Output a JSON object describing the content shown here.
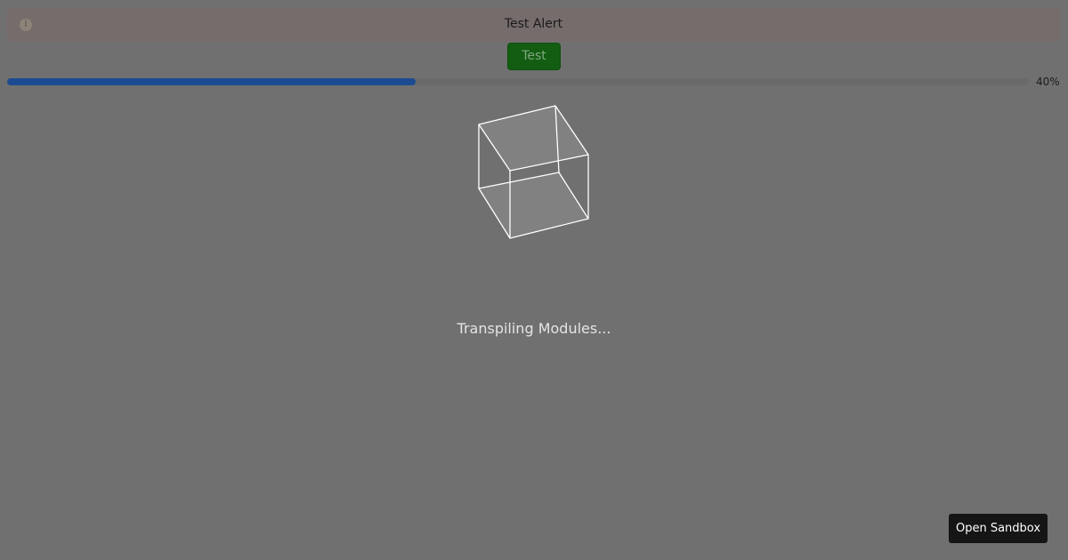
{
  "alert": {
    "icon": "info-icon",
    "title": "Test Alert"
  },
  "test_button": {
    "label": "Test"
  },
  "progress": {
    "percent": 40,
    "label": "40%",
    "color": "#1d4b92"
  },
  "loader": {
    "icon": "cube-icon",
    "status": "Transpiling Modules..."
  },
  "footer": {
    "open_sandbox_label": "Open Sandbox"
  },
  "colors": {
    "background": "#707070",
    "alert_background": "#756c6b",
    "button_green": "#125d12"
  }
}
